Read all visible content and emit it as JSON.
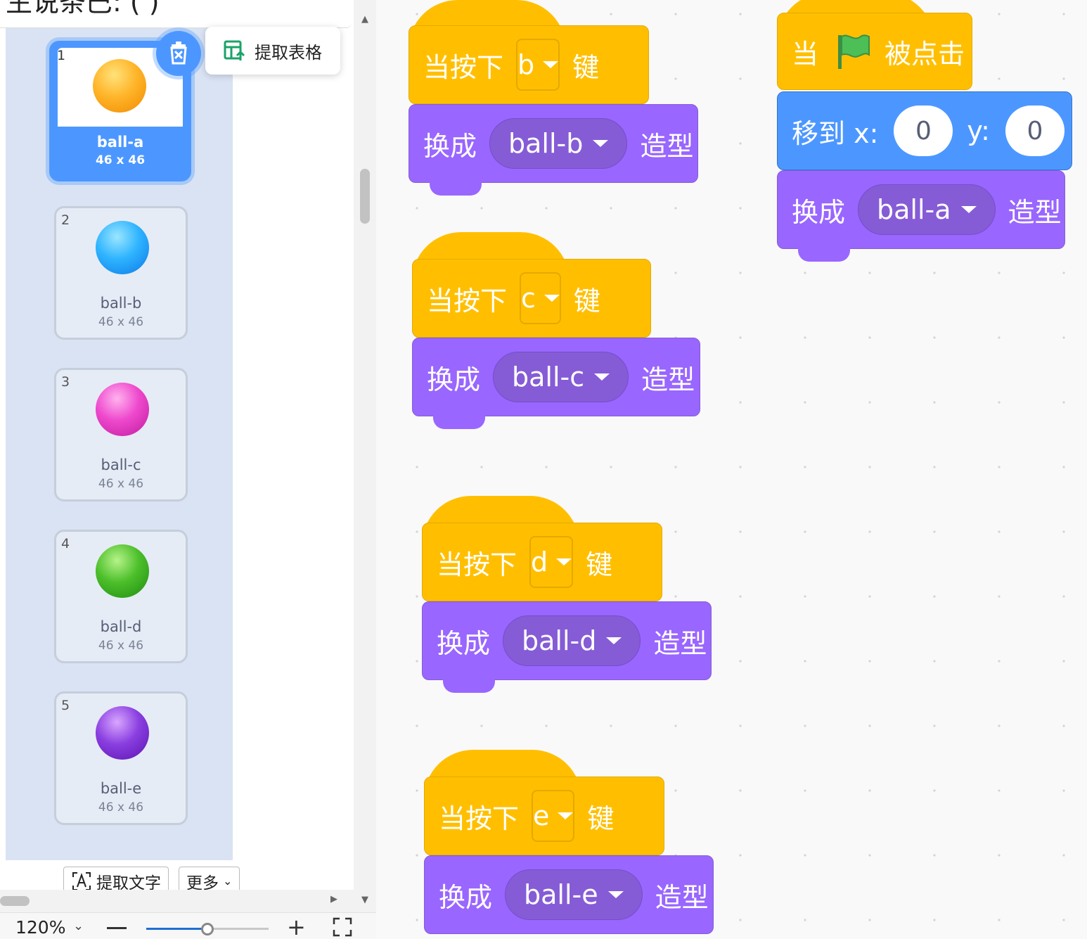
{
  "viewer": {
    "top_text": "生说条巴:  (  )",
    "extract_table_label": "提取表格",
    "extract_text_label": "提取文字",
    "more_label": "更多",
    "zoom": "120%",
    "zoom_caret": "⌄",
    "zoom_fraction": 0.5
  },
  "costumes": [
    {
      "num": "1",
      "name": "ball-a",
      "size": "46 x 46",
      "color": "#ffa820",
      "selected": true
    },
    {
      "num": "2",
      "name": "ball-b",
      "size": "46 x 46",
      "color": "#28a8ff",
      "selected": false
    },
    {
      "num": "3",
      "name": "ball-c",
      "size": "46 x 46",
      "color": "#e83fc4",
      "selected": false
    },
    {
      "num": "4",
      "name": "ball-d",
      "size": "46 x 46",
      "color": "#3fb02c",
      "selected": false
    },
    {
      "num": "5",
      "name": "ball-e",
      "size": "46 x 46",
      "color": "#7d2fd8",
      "selected": false
    }
  ],
  "scripts": {
    "key_prefix": "当按下",
    "key_suffix": "键",
    "switch_prefix": "换成",
    "switch_suffix": "造型",
    "flag_when": "当",
    "flag_clicked": "被点击",
    "goto_label": "移到 x:",
    "y_label": "y:",
    "x_value": "0",
    "y_value": "0",
    "flag_costume": "ball-a",
    "key_stacks": [
      {
        "key": "b",
        "costume": "ball-b"
      },
      {
        "key": "c",
        "costume": "ball-c"
      },
      {
        "key": "d",
        "costume": "ball-d"
      },
      {
        "key": "e",
        "costume": "ball-e"
      }
    ]
  },
  "colors": {
    "events": "#ffbf00",
    "looks": "#9966ff",
    "motion": "#4c97ff",
    "flag": "#4cbf56"
  }
}
